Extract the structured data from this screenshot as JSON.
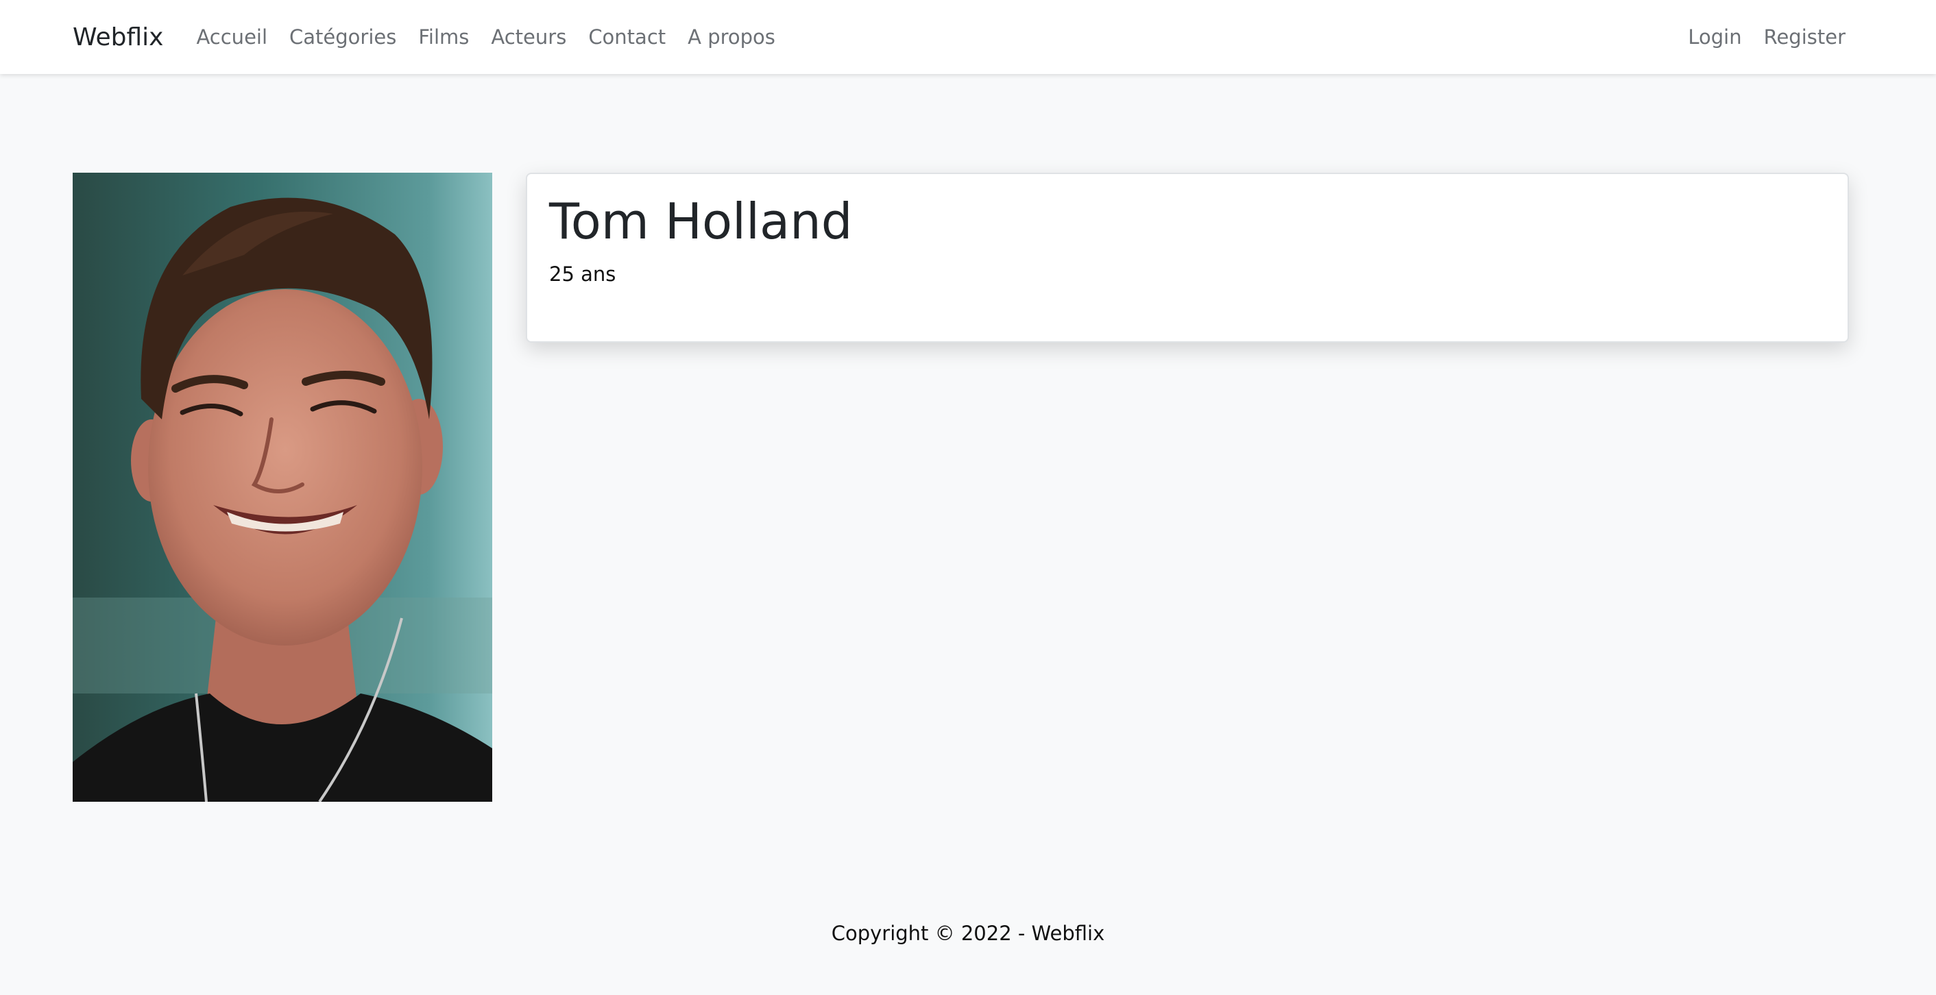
{
  "navbar": {
    "brand": "Webflix",
    "links": [
      "Accueil",
      "Catégories",
      "Films",
      "Acteurs",
      "Contact",
      "A propos"
    ],
    "auth": [
      "Login",
      "Register"
    ]
  },
  "actor": {
    "name": "Tom Holland",
    "age": "25 ans"
  },
  "footer": {
    "copyright": "Copyright © 2022 - Webflix"
  }
}
